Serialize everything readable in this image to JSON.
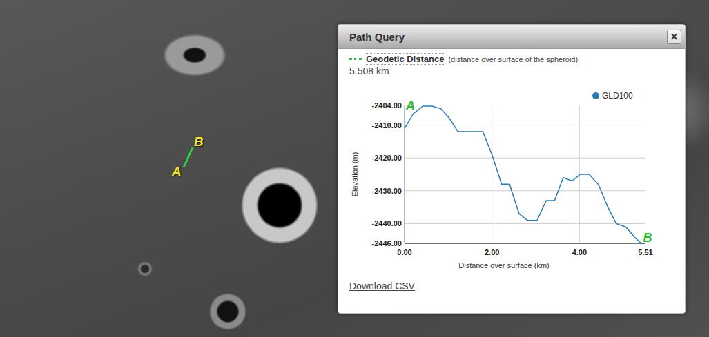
{
  "map": {
    "path_labels": [
      "A",
      "B"
    ]
  },
  "panel": {
    "title": "Path Query",
    "close": "×",
    "legend": {
      "label": "Geodetic Distance",
      "note": "(distance over surface of the spheroid)"
    },
    "distance": "5.508 km",
    "chart": {
      "y_axis_title": "Elevation (m)",
      "x_axis_title": "Distance over surface (km)",
      "y_ticks": [
        "-2404.00",
        "-2410.00",
        "-2420.00",
        "-2430.00",
        "-2440.00",
        "-2446.00"
      ],
      "x_ticks": [
        "0.00",
        "2.00",
        "4.00",
        "5.51"
      ],
      "endpoint_labels": [
        "A",
        "B"
      ],
      "series": [
        {
          "name": "GLD100",
          "color": "#2a7ab0",
          "distance_km": [
            0,
            0.2,
            0.42,
            0.63,
            0.83,
            1.03,
            1.22,
            1.79,
            2.0,
            2.22,
            2.4,
            2.62,
            2.81,
            3.03,
            3.24,
            3.43,
            3.63,
            3.83,
            4.02,
            4.22,
            4.43,
            4.65,
            4.84,
            5.06,
            5.25,
            5.41,
            5.51
          ],
          "elevation_m": [
            -2411,
            -2406.5,
            -2404.2,
            -2404.2,
            -2405,
            -2408,
            -2412,
            -2412,
            -2419,
            -2428,
            -2428,
            -2437,
            -2439,
            -2439,
            -2433,
            -2433,
            -2426,
            -2427,
            -2425,
            -2425,
            -2428,
            -2435,
            -2440,
            -2441,
            -2444,
            -2446,
            -2446
          ]
        }
      ]
    },
    "download_link": "Download CSV"
  }
}
